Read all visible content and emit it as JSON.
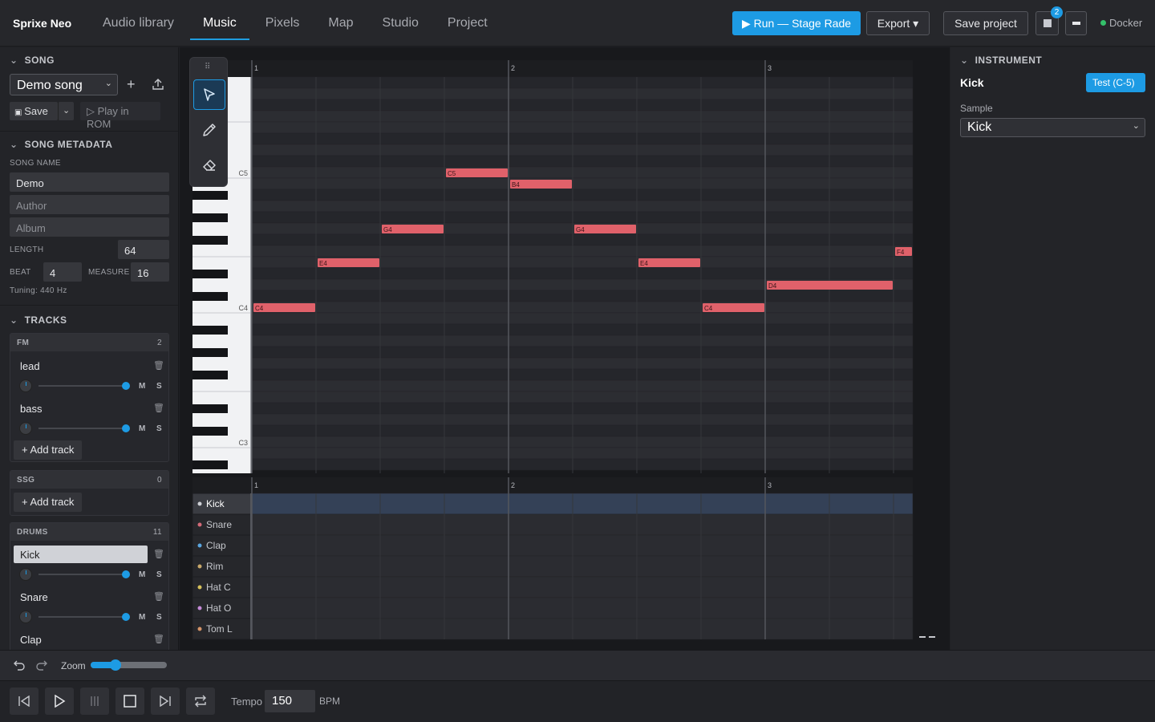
{
  "app": {
    "brand": "Sprixe Neo"
  },
  "nav": {
    "tabs": [
      "Audio library",
      "Music",
      "Pixels",
      "Map",
      "Studio",
      "Project"
    ],
    "active": "Music"
  },
  "header": {
    "run_label": "▶ Run — Stage Rade",
    "export_label": "Export ▾",
    "save_project_label": "Save project",
    "notif_count": "2",
    "status_label": "Docker",
    "status_color": "#34c06a"
  },
  "song": {
    "section_title": "SONG",
    "selected": "Demo song",
    "save_label": "Save",
    "play_label": "▷ Play in ROM"
  },
  "metadata": {
    "section_title": "SONG METADATA",
    "song_name_label": "SONG NAME",
    "song_name": "Demo",
    "author_placeholder": "Author",
    "album_placeholder": "Album",
    "length_label": "LENGTH",
    "length": "64",
    "beat_label": "BEAT",
    "beat": "4",
    "measure_label": "MEASURE",
    "measure": "16",
    "tuning": "Tuning: 440 Hz"
  },
  "tracks": {
    "section_title": "TRACKS",
    "fm": {
      "name": "FM",
      "count": "2",
      "items": [
        "lead",
        "bass"
      ],
      "add_label": "+ Add track"
    },
    "ssg": {
      "name": "SSG",
      "count": "0",
      "add_label": "+ Add track"
    },
    "drums": {
      "name": "DRUMS",
      "count": "11",
      "items": [
        "Kick",
        "Snare",
        "Clap"
      ]
    },
    "mute": "M",
    "solo": "S"
  },
  "piano_roll": {
    "bar_numbers": [
      "1",
      "2",
      "3"
    ],
    "key_labels": [
      "C5",
      "C4",
      "C3"
    ],
    "notes": [
      {
        "pitch": "C4",
        "start": 0,
        "len": 1
      },
      {
        "pitch": "E4",
        "start": 1,
        "len": 1
      },
      {
        "pitch": "G4",
        "start": 2,
        "len": 1
      },
      {
        "pitch": "C5",
        "start": 3,
        "len": 1
      },
      {
        "pitch": "B4",
        "start": 4,
        "len": 1
      },
      {
        "pitch": "G4",
        "start": 5,
        "len": 1
      },
      {
        "pitch": "E4",
        "start": 6,
        "len": 1
      },
      {
        "pitch": "C4",
        "start": 7,
        "len": 1
      },
      {
        "pitch": "D4",
        "start": 8,
        "len": 2
      },
      {
        "pitch": "F4",
        "start": 10,
        "len": 0.3
      }
    ],
    "note_color": "#e0616a"
  },
  "drum_lanes": [
    {
      "name": "Kick",
      "color": "#cfd1d6"
    },
    {
      "name": "Snare",
      "color": "#d46a78"
    },
    {
      "name": "Clap",
      "color": "#5aa6e0"
    },
    {
      "name": "Rim",
      "color": "#c8a86a"
    },
    {
      "name": "Hat C",
      "color": "#d6c15a"
    },
    {
      "name": "Hat O",
      "color": "#c58ad8"
    },
    {
      "name": "Tom L",
      "color": "#d59468"
    }
  ],
  "instrument": {
    "section_title": "INSTRUMENT",
    "name": "Kick",
    "test_label": "Test (C-5)",
    "sample_label": "Sample",
    "sample": "Kick"
  },
  "footer": {
    "zoom_label": "Zoom",
    "zoom_level": 0.33,
    "tempo_label": "Tempo",
    "tempo": "150",
    "bpm_label": "BPM"
  }
}
